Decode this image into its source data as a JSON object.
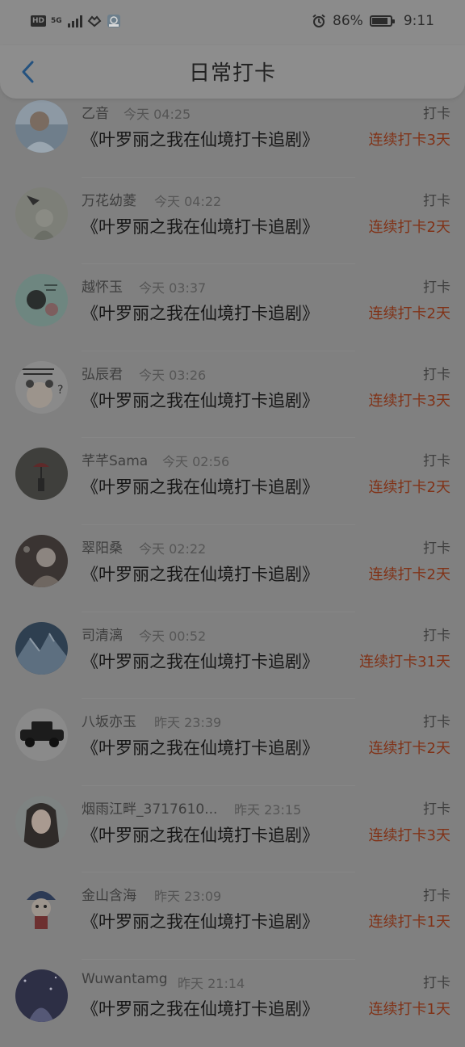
{
  "status_bar": {
    "hd": "HD",
    "network": "5G",
    "battery_percent": "86%",
    "battery_level": 0.86,
    "time": "9:11"
  },
  "header": {
    "title": "日常打卡"
  },
  "entries": [
    {
      "name": "乙音",
      "time": "今天 04:25",
      "action": "打卡",
      "title": "《叶罗丽之我在仙境打卡追剧》",
      "streak": "连续打卡3天"
    },
    {
      "name": "万花幼菱",
      "time": "今天 04:22",
      "action": "打卡",
      "title": "《叶罗丽之我在仙境打卡追剧》",
      "streak": "连续打卡2天"
    },
    {
      "name": "越怀玉",
      "time": "今天 03:37",
      "action": "打卡",
      "title": "《叶罗丽之我在仙境打卡追剧》",
      "streak": "连续打卡2天"
    },
    {
      "name": "弘辰君",
      "time": "今天 03:26",
      "action": "打卡",
      "title": "《叶罗丽之我在仙境打卡追剧》",
      "streak": "连续打卡3天"
    },
    {
      "name": "芊芊Sama",
      "time": "今天 02:56",
      "action": "打卡",
      "title": "《叶罗丽之我在仙境打卡追剧》",
      "streak": "连续打卡2天"
    },
    {
      "name": "翠阳桑",
      "time": "今天 02:22",
      "action": "打卡",
      "title": "《叶罗丽之我在仙境打卡追剧》",
      "streak": "连续打卡2天"
    },
    {
      "name": "司清漓",
      "time": "今天 00:52",
      "action": "打卡",
      "title": "《叶罗丽之我在仙境打卡追剧》",
      "streak": "连续打卡31天"
    },
    {
      "name": "八坂亦玉",
      "time": "昨天 23:39",
      "action": "打卡",
      "title": "《叶罗丽之我在仙境打卡追剧》",
      "streak": "连续打卡2天"
    },
    {
      "name": "烟雨江畔_3717610...",
      "time": "昨天 23:15",
      "action": "打卡",
      "title": "《叶罗丽之我在仙境打卡追剧》",
      "streak": "连续打卡3天"
    },
    {
      "name": "金山含海",
      "time": "昨天 23:09",
      "action": "打卡",
      "title": "《叶罗丽之我在仙境打卡追剧》",
      "streak": "连续打卡1天"
    },
    {
      "name": "Wuwantamg",
      "time": "昨天 21:14",
      "action": "打卡",
      "title": "《叶罗丽之我在仙境打卡追剧》",
      "streak": "连续打卡1天"
    }
  ],
  "colors": {
    "accent_back": "#24527f",
    "streak": "#803217"
  }
}
